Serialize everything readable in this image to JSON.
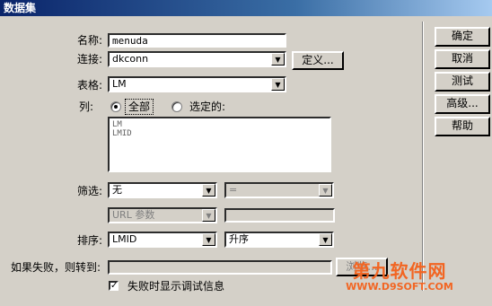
{
  "window": {
    "title": "数据集"
  },
  "form": {
    "name_label": "名称:",
    "name_value": "menuda",
    "connection_label": "连接:",
    "connection_value": "dkconn",
    "define_button": "定义...",
    "table_label": "表格:",
    "table_value": "LM",
    "columns_label": "列:",
    "radio_all": "全部",
    "radio_selected": "选定的:",
    "columns_list": [
      "LM",
      "LMID"
    ],
    "filter_label": "筛选:",
    "filter_value": "无",
    "filter_operator": "=",
    "url_param": "URL 参数",
    "url_param_value": "",
    "sort_label": "排序:",
    "sort_value": "LMID",
    "sort_order": "升序",
    "on_fail_label": "如果失败，则转到:",
    "on_fail_value": "",
    "browse_button": "浏览...",
    "debug_checkbox_label": "失败时显示调试信息",
    "debug_checked": true
  },
  "buttons": {
    "ok": "确定",
    "cancel": "取消",
    "test": "测试",
    "advanced": "高级...",
    "help": "帮助"
  },
  "watermark": {
    "title": "第九软件网",
    "subtitle": "WWW.D9SOFT.COM"
  },
  "colors": {
    "dialog_bg": "#d4d0c8",
    "titlebar_start": "#0a246a",
    "watermark": "#f26522"
  }
}
